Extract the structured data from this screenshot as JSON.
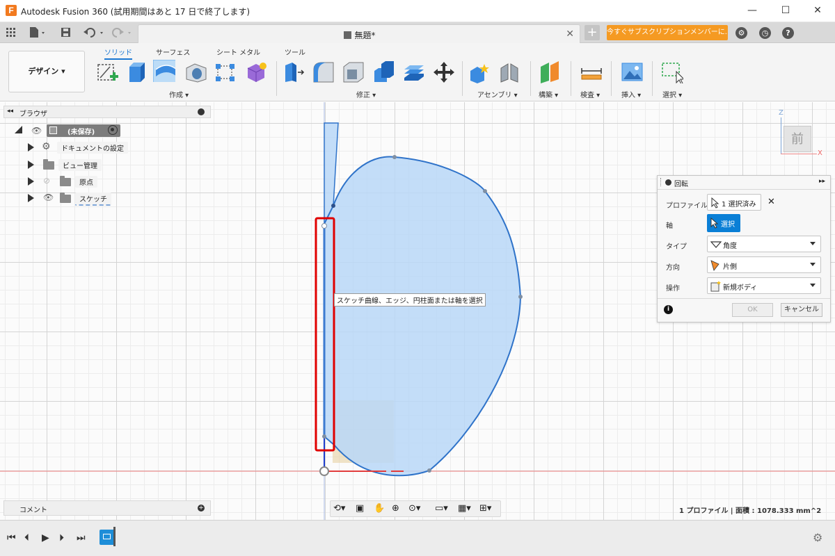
{
  "window": {
    "title": "Autodesk Fusion 360 (試用期間はあと 17 日で終了します)",
    "logo_letter": "F",
    "minimize": "—",
    "maximize": "☐",
    "close": "✕"
  },
  "tabbar": {
    "doc_title": "無題*",
    "close": "✕",
    "new_tab": "+",
    "subscription": "今すぐサブスクリプションメンバーに..."
  },
  "ribbon": {
    "workspace": "デザイン",
    "tabs": [
      "ソリッド",
      "サーフェス",
      "シート メタル",
      "ツール"
    ],
    "groups": [
      "作成",
      "修正",
      "アセンブリ",
      "構築",
      "検査",
      "挿入",
      "選択"
    ]
  },
  "browser": {
    "title": "ブラウザ",
    "root": "(未保存)",
    "items": [
      "ドキュメントの設定",
      "ビュー管理",
      "原点",
      "スケッチ"
    ]
  },
  "viewcube": {
    "face": "前",
    "z": "Z",
    "x": "X"
  },
  "tooltip": "スケッチ曲線、エッジ、円柱面または軸を選択",
  "revolve": {
    "title": "回転",
    "rows": [
      {
        "label": "プロファイル",
        "value": "1 選択済み"
      },
      {
        "label": "軸",
        "value": "選択"
      },
      {
        "label": "タイプ",
        "value": "角度"
      },
      {
        "label": "方向",
        "value": "片側"
      },
      {
        "label": "操作",
        "value": "新規ボディ"
      }
    ],
    "ok": "OK",
    "cancel": "キャンセル",
    "clear": "✕",
    "info": "i"
  },
  "comments": {
    "title": "コメント"
  },
  "status": "1 プロファイル | 面積 : 1078.333 mm^2",
  "colors": {
    "accent": "#1976d2",
    "subscription": "#f59a22",
    "profile_fill": "#b8d7f7",
    "profile_stroke": "#2f73c9",
    "highlight": "#e00000"
  }
}
